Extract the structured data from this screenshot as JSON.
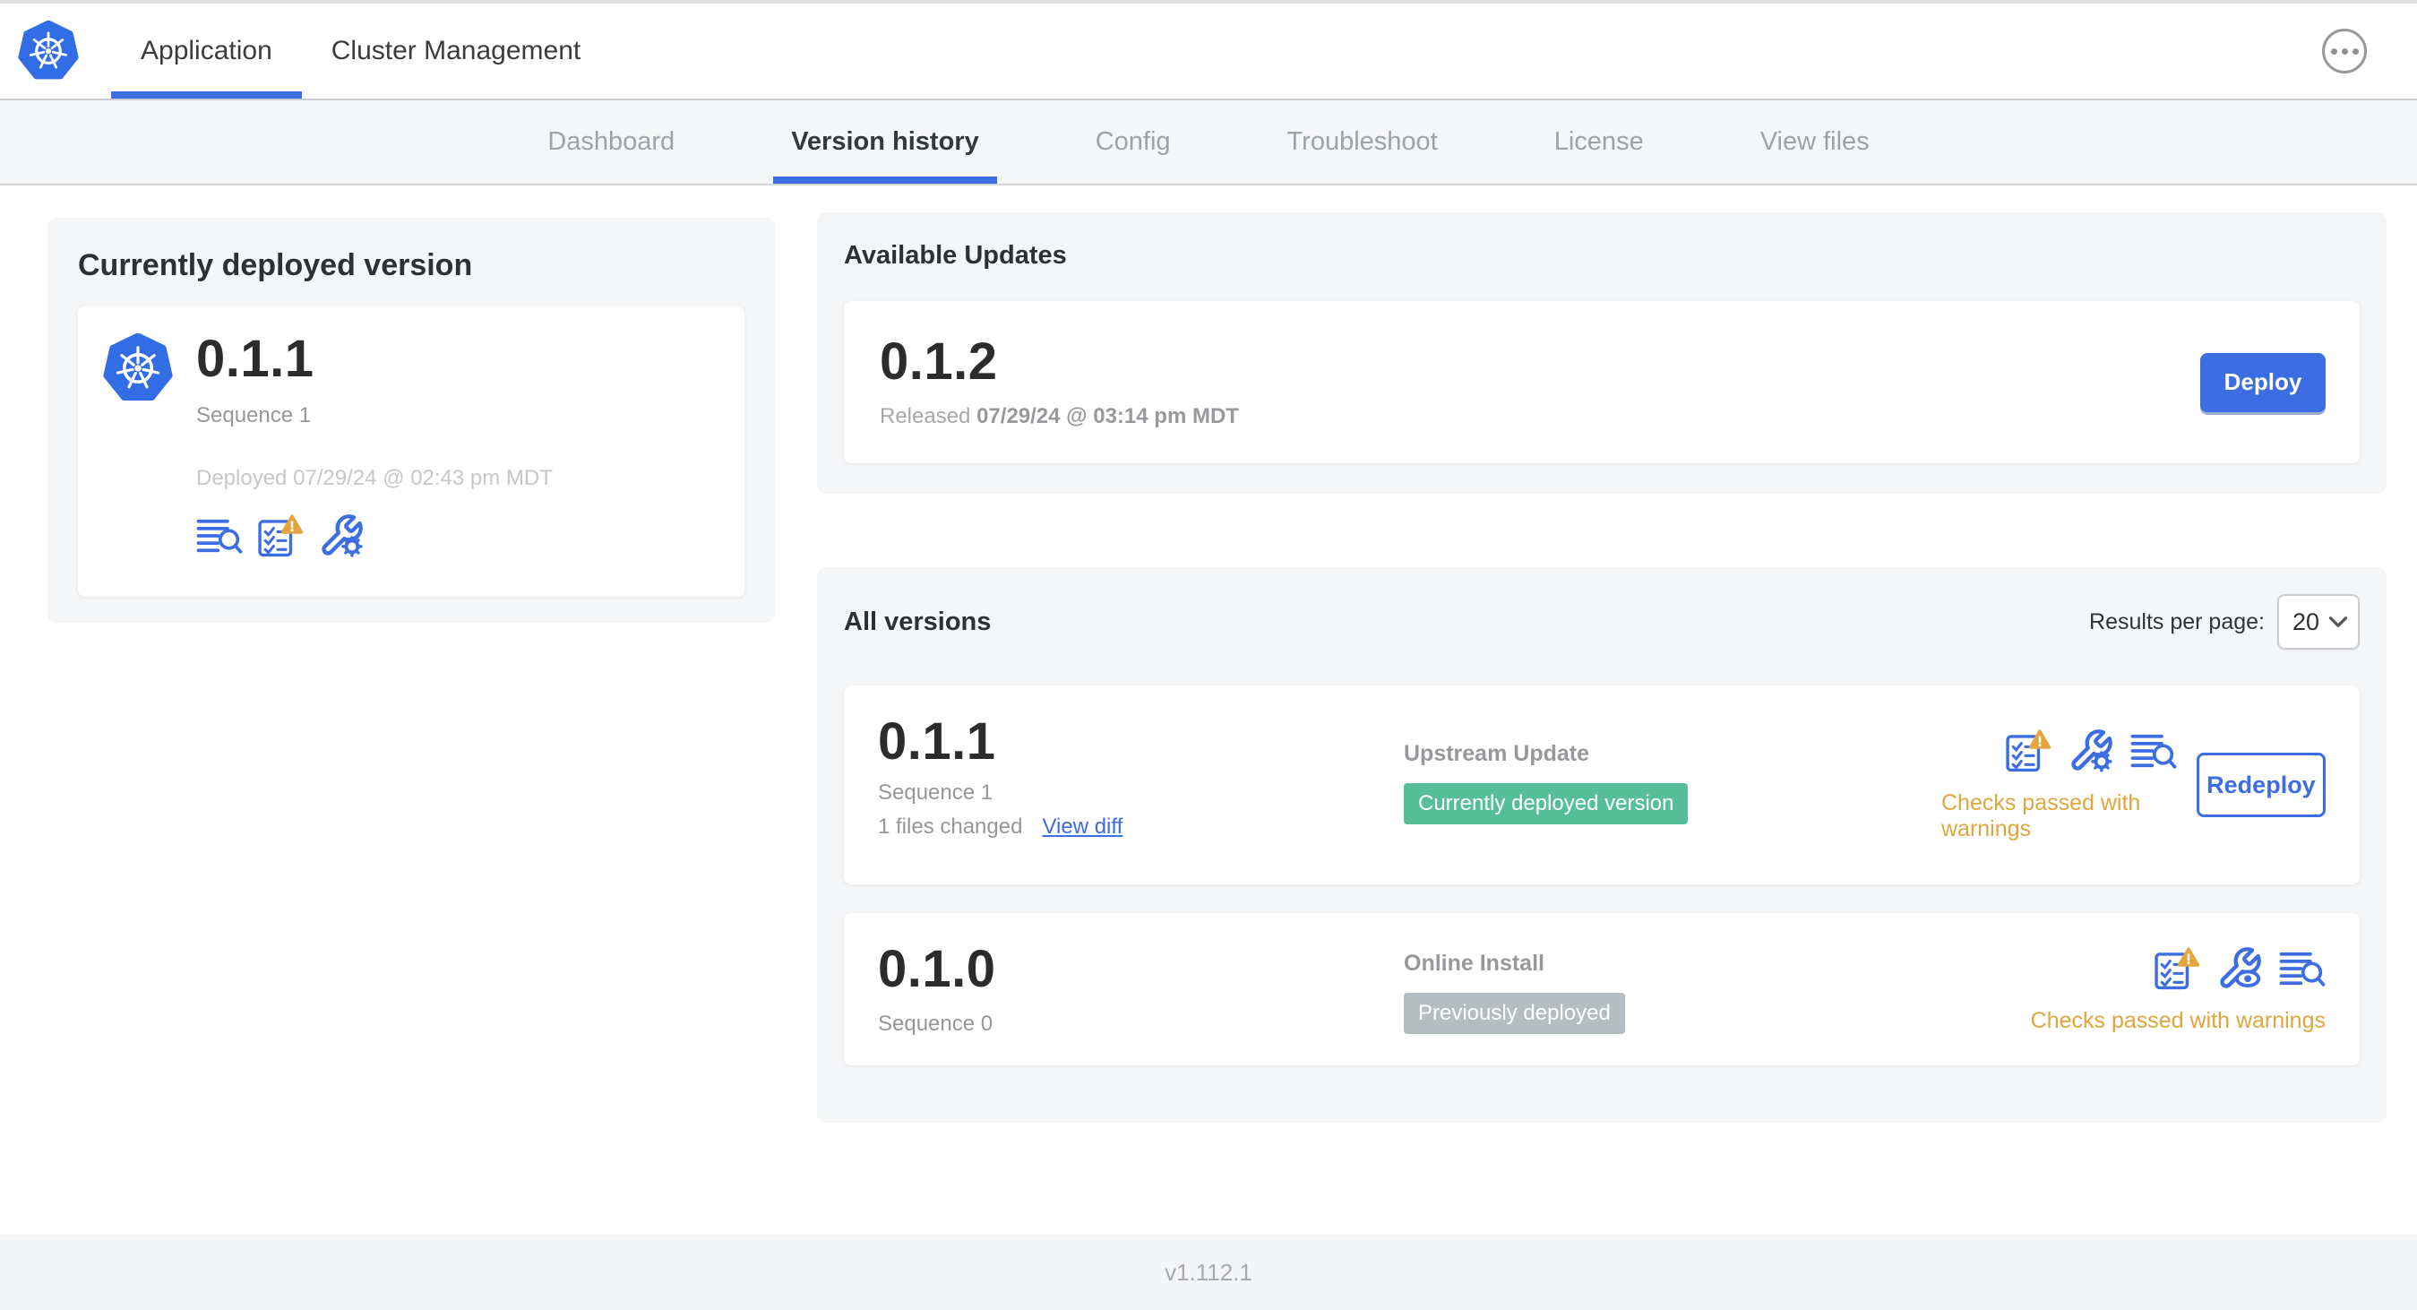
{
  "topnav": {
    "tabs": [
      {
        "label": "Application"
      },
      {
        "label": "Cluster Management"
      }
    ]
  },
  "subnav": {
    "tabs": [
      {
        "label": "Dashboard"
      },
      {
        "label": "Version history"
      },
      {
        "label": "Config"
      },
      {
        "label": "Troubleshoot"
      },
      {
        "label": "License"
      },
      {
        "label": "View files"
      }
    ]
  },
  "current_version": {
    "title": "Currently deployed version",
    "version": "0.1.1",
    "sequence": "Sequence 1",
    "deployed": "Deployed 07/29/24 @ 02:43 pm MDT"
  },
  "available_updates": {
    "title": "Available Updates",
    "version": "0.1.2",
    "released_label": "Released",
    "released_date": "07/29/24 @ 03:14 pm MDT",
    "deploy_label": "Deploy"
  },
  "all_versions": {
    "title": "All versions",
    "results_per_page_label": "Results per page:",
    "results_per_page_value": "20",
    "rows": [
      {
        "version": "0.1.1",
        "sequence": "Sequence 1",
        "files_changed": "1 files changed",
        "view_diff_label": "View diff",
        "source": "Upstream Update",
        "badge": "Currently deployed version",
        "checks_status": "Checks passed with warnings",
        "action_label": "Redeploy"
      },
      {
        "version": "0.1.0",
        "sequence": "Sequence 0",
        "source": "Online Install",
        "badge": "Previously deployed",
        "checks_status": "Checks passed with warnings"
      }
    ]
  },
  "footer": {
    "version": "v1.112.1"
  },
  "icons": {
    "app-logo": "kubernetes-helm-wheel-heptagon",
    "menu": "ellipsis-in-circle",
    "version-diff": "text-lines-with-magnifier",
    "preflight-checks-warning": "checklist-with-warning-triangle",
    "edit-config": "wrench-with-gear",
    "view-config": "wrench-with-eye",
    "select-chevron": "chevron-down"
  },
  "colors": {
    "accent_blue": "#3d6de2",
    "kubernetes_blue": "#326de6",
    "warning_amber": "#e6a53c",
    "badge_green": "#56bf9a",
    "badge_gray": "#b4bec1",
    "card_gray": "#f4f6f8"
  }
}
